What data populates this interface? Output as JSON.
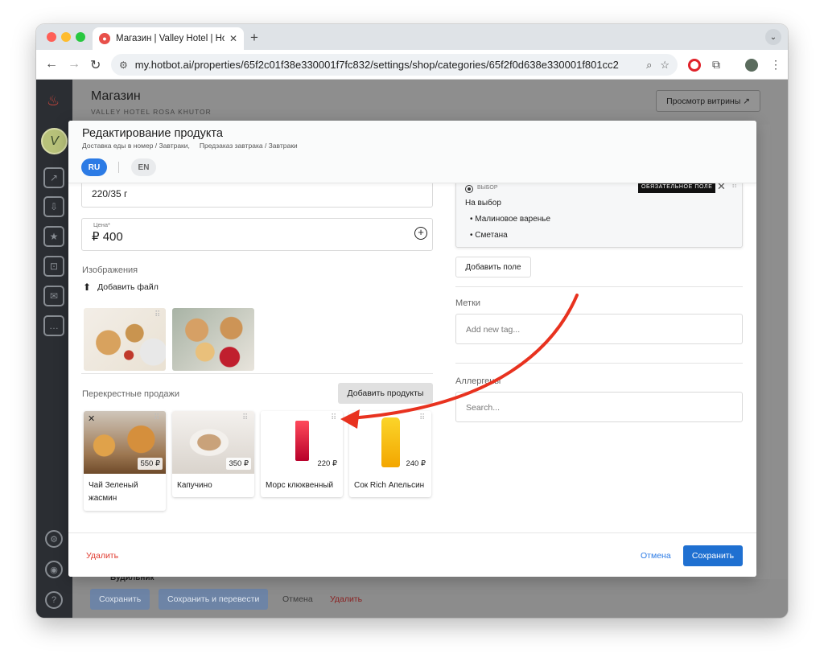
{
  "browser": {
    "tab_title": "Магазин | Valley Hotel | Hotbot",
    "url": "my.hotbot.ai/properties/65f2c01f38e330001f7fc832/settings/shop/categories/65f2f0d638e330001f801cc2"
  },
  "page": {
    "title": "Магазин",
    "subtitle": "VALLEY HOTEL ROSA KHUTOR",
    "storefront_button": "Просмотр витрины ↗",
    "bg_item_name": "Будильник",
    "bg_save": "Сохранить",
    "bg_save_translate": "Сохранить и перевести",
    "bg_cancel": "Отмена",
    "bg_delete": "Удалить"
  },
  "modal": {
    "title": "Редактирование продукта",
    "crumb1": "Доставка еды в номер / Завтраки,",
    "crumb2": "Предзаказ завтрака / Завтраки",
    "lang_ru": "RU",
    "lang_en": "EN",
    "weight_value": "220/35 г",
    "price_label": "Цена*",
    "price_value": "₽ 400",
    "images_label": "Изображения",
    "add_file": "Добавить файл",
    "cross_sales_label": "Перекрестные продажи",
    "add_products": "Добавить продукты",
    "cross_products": [
      {
        "name": "Чай Зеленый жасмин",
        "price": "550 ₽"
      },
      {
        "name": "Капучино",
        "price": "350 ₽"
      },
      {
        "name": "Морс клюквенный",
        "price": "220 ₽"
      },
      {
        "name": "Сок Rich Апельсин",
        "price": "240 ₽"
      }
    ],
    "option": {
      "type": "ВЫБОР",
      "required": "ОБЯЗАТЕЛЬНОЕ ПОЛЕ",
      "title": "На выбор",
      "items": [
        "• Малиновое варенье",
        "• Сметана"
      ]
    },
    "add_field": "Добавить поле",
    "tags_label": "Метки",
    "tags_placeholder": "Add new tag...",
    "allergens_label": "Аллергены",
    "allergens_placeholder": "Search...",
    "delete": "Удалить",
    "cancel": "Отмена",
    "save": "Сохранить"
  },
  "colors": {
    "primary": "#1f70d1",
    "danger": "#e03a2f",
    "arrow": "#e8321f"
  }
}
